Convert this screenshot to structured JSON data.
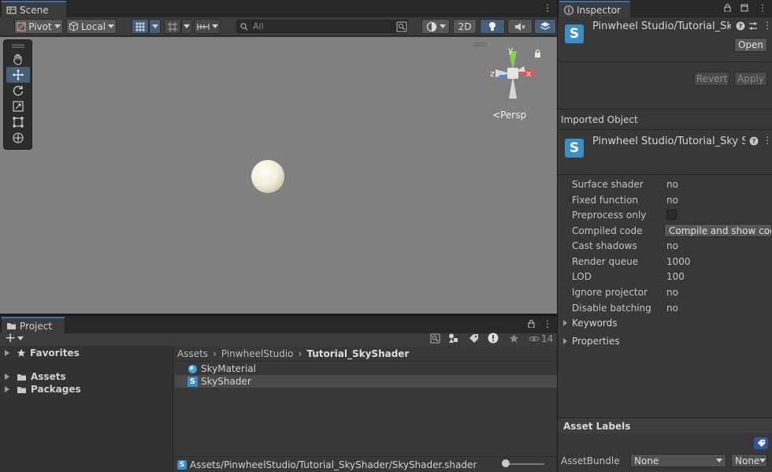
{
  "scene": {
    "tab_label": "Scene",
    "toolbar": {
      "pivot_label": "Pivot",
      "local_label": "Local",
      "search_placeholder": "All",
      "mode_2d_label": "2D"
    },
    "gizmo": {
      "y_label": "y",
      "x_label": "x",
      "z_label": "z",
      "persp_label": "Persp"
    },
    "tools": [
      "hand-icon",
      "move-icon",
      "rotate-icon",
      "scale-icon",
      "rect-icon",
      "transform-icon"
    ],
    "active_tool": "move-icon"
  },
  "project": {
    "tab_label": "Project",
    "add_label": "+",
    "visible_count": "14",
    "tree": {
      "favorites_label": "Favorites",
      "assets_label": "Assets",
      "packages_label": "Packages"
    },
    "breadcrumb": [
      "Assets",
      "PinwheelStudio",
      "Tutorial_SkyShader"
    ],
    "items": [
      {
        "name": "SkyMaterial",
        "type": "material",
        "selected": false
      },
      {
        "name": "SkyShader",
        "type": "shader",
        "selected": true
      }
    ],
    "status_path": "Assets/PinwheelStudio/Tutorial_SkyShader/SkyShader.shader"
  },
  "inspector": {
    "tab_label": "Inspector",
    "title": "Pinwheel Studio/Tutorial_Sky",
    "open_label": "Open",
    "revert_label": "Revert",
    "apply_label": "Apply",
    "imported_object_label": "Imported Object",
    "imported_title": "Pinwheel Studio/Tutorial_Sky S",
    "properties": {
      "surface_shader_label": "Surface shader",
      "surface_shader_value": "no",
      "fixed_function_label": "Fixed function",
      "fixed_function_value": "no",
      "preprocess_only_label": "Preprocess only",
      "preprocess_only_checked": false,
      "compiled_code_label": "Compiled code",
      "compiled_code_button": "Compile and show code",
      "cast_shadows_label": "Cast shadows",
      "cast_shadows_value": "no",
      "render_queue_label": "Render queue",
      "render_queue_value": "1000",
      "lod_label": "LOD",
      "lod_value": "100",
      "ignore_projector_label": "Ignore projector",
      "ignore_projector_value": "no",
      "disable_batching_label": "Disable batching",
      "disable_batching_value": "no"
    },
    "keywords_label": "Keywords",
    "properties_label": "Properties",
    "asset_labels_label": "Asset Labels",
    "asset_bundle_label": "AssetBundle",
    "asset_bundle_value": "None",
    "asset_bundle_variant": "None"
  },
  "colors": {
    "accent": "#3a72b0",
    "active_tool": "#46607c",
    "shader_icon": "#3c8ec4",
    "viewport": "#808080"
  }
}
